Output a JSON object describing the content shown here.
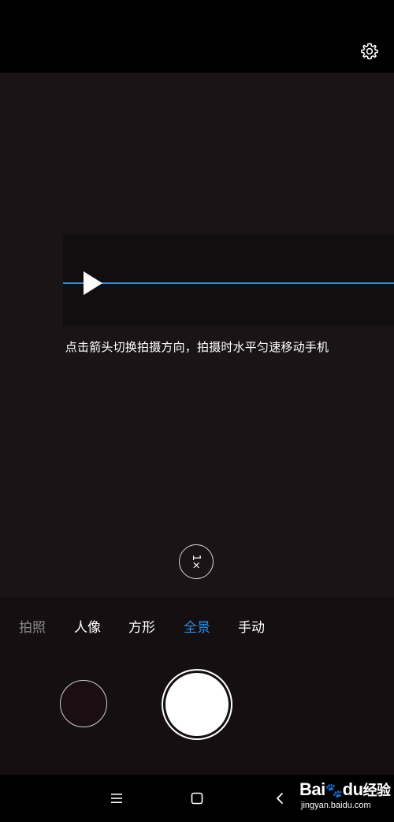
{
  "top_bar": {
    "settings_icon": "gear-icon"
  },
  "viewfinder": {
    "hint_text": "点击箭头切换拍摄方向，拍摄时水平匀速移动手机",
    "zoom_label": "1×",
    "guide_line_color": "#3b8fd6",
    "arrow_icon": "play-arrow-icon"
  },
  "modes": {
    "items": [
      {
        "label": "拍照"
      },
      {
        "label": "人像"
      },
      {
        "label": "方形"
      },
      {
        "label": "全景"
      },
      {
        "label": "手动"
      }
    ],
    "active": "全景",
    "active_color": "#2f8be0"
  },
  "controls": {
    "gallery_icon": "gallery-thumbnail",
    "shutter_icon": "shutter-button"
  },
  "nav_bar": {
    "menu_icon": "menu-icon",
    "home_icon": "home-square-icon",
    "back_icon": "back-chevron-icon"
  },
  "watermark": {
    "logo_text": "Bai",
    "logo_paw": "du",
    "logo_cn": "经验",
    "url": "jingyan.baidu.com"
  }
}
